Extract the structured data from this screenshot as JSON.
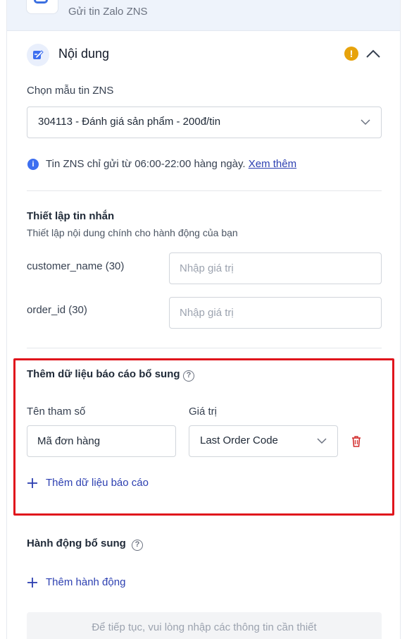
{
  "header": {
    "step_label": "Gửi tin Zalo ZNS"
  },
  "content_section": {
    "title": "Nội dung",
    "template_label": "Chọn mẫu tin ZNS",
    "template_value": "304113 - Đánh giá sản phẩm - 200đ/tin",
    "info_text": "Tin ZNS chỉ gửi từ 06:00-22:00 hàng ngày.",
    "info_link": "Xem thêm"
  },
  "message_setup": {
    "title": "Thiết lập tin nhắn",
    "description": "Thiết lập nội dung chính cho hành động của bạn",
    "fields": [
      {
        "label": "customer_name (30)",
        "placeholder": "Nhập giá trị",
        "value": ""
      },
      {
        "label": "order_id (30)",
        "placeholder": "Nhập giá trị",
        "value": ""
      }
    ]
  },
  "report_data": {
    "title": "Thêm dữ liệu báo cáo bổ sung",
    "param_col_label": "Tên tham số",
    "value_col_label": "Giá trị",
    "rows": [
      {
        "param": "Mã đơn hàng",
        "value": "Last Order Code"
      }
    ],
    "add_label": "Thêm dữ liệu báo cáo"
  },
  "extra_actions": {
    "title": "Hành động bổ sung",
    "add_label": "Thêm hành động"
  },
  "footer": {
    "hint": "Để tiếp tục, vui lòng nhập các thông tin cần thiết"
  },
  "colors": {
    "accent": "#2c3fb1",
    "warning": "#e7a30c",
    "highlight_border": "#e0151c",
    "delete": "#d32f2f"
  },
  "icons": {
    "header": "zalo-icon",
    "section": "edit-icon",
    "warning": "warning-icon",
    "collapse": "chevron-up-icon",
    "dropdown": "chevron-down-icon",
    "info": "info-icon",
    "help": "help-icon",
    "delete": "trash-icon",
    "add": "plus-icon"
  }
}
